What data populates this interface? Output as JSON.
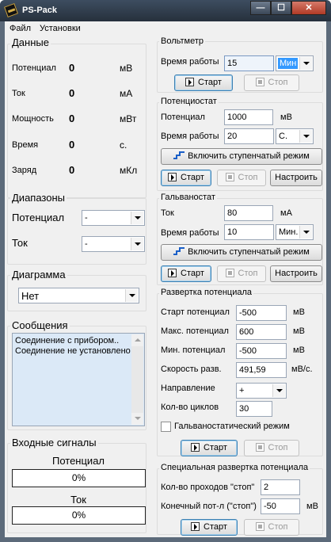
{
  "window": {
    "title": "PS-Pack",
    "buttons": {
      "minimize": "—",
      "maximize": "☐",
      "close": "✕"
    }
  },
  "menu": {
    "file": "Файл",
    "settings": "Установки"
  },
  "data_group": {
    "title": "Данные",
    "rows": [
      {
        "label": "Потенциал",
        "value": "0",
        "unit": "мВ"
      },
      {
        "label": "Ток",
        "value": "0",
        "unit": "мА"
      },
      {
        "label": "Мощность",
        "value": "0",
        "unit": "мВт"
      },
      {
        "label": "Время",
        "value": "0",
        "unit": "с."
      },
      {
        "label": "Заряд",
        "value": "0",
        "unit": "мКл"
      }
    ]
  },
  "ranges_group": {
    "title": "Диапазоны",
    "potential_label": "Потенциал",
    "potential_value": "-",
    "current_label": "Ток",
    "current_value": "-"
  },
  "diagram_group": {
    "title": "Диаграмма",
    "value": "Нет"
  },
  "messages_group": {
    "title": "Сообщения",
    "lines": [
      "Соединение с прибором..",
      "Соединение не установлено"
    ]
  },
  "inputs_group": {
    "title": "Входные сигналы",
    "potential_label": "Потенциал",
    "potential_percent": "0%",
    "potential_fill": 0,
    "current_label": "Ток",
    "current_percent": "0%",
    "current_fill": 0
  },
  "voltmeter": {
    "title": "Вольтметр",
    "time_label": "Время работы",
    "time_value": "15",
    "time_unit": "Мин",
    "start": "Старт",
    "stop": "Стоп"
  },
  "potentiostat": {
    "title": "Потенциостат",
    "potential_label": "Потенциал",
    "potential_value": "1000",
    "potential_unit": "мВ",
    "time_label": "Время работы",
    "time_value": "20",
    "time_unit": "С.",
    "step_mode": "Включить ступенчатый режим",
    "start": "Старт",
    "stop": "Стоп",
    "configure": "Настроить"
  },
  "galvanostat": {
    "title": "Гальваностат",
    "current_label": "Ток",
    "current_value": "80",
    "current_unit": "мА",
    "time_label": "Время работы",
    "time_value": "10",
    "time_unit": "Мин.",
    "step_mode": "Включить ступенчатый режим",
    "start": "Старт",
    "stop": "Стоп",
    "configure": "Настроить"
  },
  "sweep": {
    "title": "Развертка потенциала",
    "start_label": "Старт потенциал",
    "start_value": "-500",
    "start_unit": "мВ",
    "max_label": "Макс. потенциал",
    "max_value": "600",
    "max_unit": "мВ",
    "min_label": "Мин. потенциал",
    "min_value": "-500",
    "min_unit": "мВ",
    "rate_label": "Скорость разв.",
    "rate_value": "491,59",
    "rate_unit": "мВ/с.",
    "direction_label": "Направление",
    "direction_value": "+",
    "cycles_label": "Кол-во циклов",
    "cycles_value": "30",
    "galvano_check": "Гальваностатический режим",
    "start": "Старт",
    "stop": "Стоп"
  },
  "special_sweep": {
    "title": "Специальная развертка потенциала",
    "passes_label": "Кол-во проходов \"стоп\"",
    "passes_value": "2",
    "final_label": "Конечный пот-л (\"стоп\")",
    "final_value": "-50",
    "final_unit": "мВ",
    "start": "Старт",
    "stop": "Стоп"
  }
}
